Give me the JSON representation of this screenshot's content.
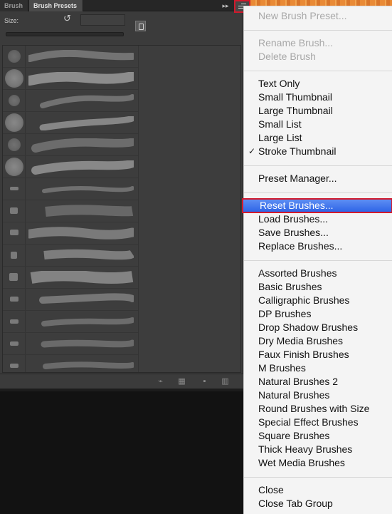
{
  "panel": {
    "tabs": [
      {
        "label": "Brush"
      },
      {
        "label": "Brush Presets"
      }
    ],
    "size_label": "Size:",
    "size_value": ""
  },
  "icons": {
    "collapse": "double-chevron-right-icon",
    "panel_menu": "panel-menu-icon",
    "reset_size": "reset-arrow-icon",
    "create_brush": "create-new-brush-icon",
    "toggle_brush_panel": "brush-panel-icon",
    "open_preset_manager": "grid-icon",
    "new_preset": "new-page-icon",
    "delete": "trash-icon"
  },
  "colors": {
    "panel_bg": "#3b3b3b",
    "menu_bg": "#f4f4f4",
    "highlight": "#2f65e7",
    "callout_border": "#d2192c"
  },
  "menu": {
    "new_brush_preset": "New Brush Preset...",
    "rename_brush": "Rename Brush...",
    "delete_brush": "Delete Brush",
    "text_only": "Text Only",
    "small_thumbnail": "Small Thumbnail",
    "large_thumbnail": "Large Thumbnail",
    "small_list": "Small List",
    "large_list": "Large List",
    "stroke_thumbnail": "Stroke Thumbnail",
    "checkmark": "✓",
    "preset_manager": "Preset Manager...",
    "reset_brushes": "Reset Brushes...",
    "load_brushes": "Load Brushes...",
    "save_brushes": "Save Brushes...",
    "replace_brushes": "Replace Brushes...",
    "libraries": [
      "Assorted Brushes",
      "Basic Brushes",
      "Calligraphic Brushes",
      "DP Brushes",
      "Drop Shadow Brushes",
      "Dry Media Brushes",
      "Faux Finish Brushes",
      "M Brushes",
      "Natural Brushes 2",
      "Natural Brushes",
      "Round Brushes with Size",
      "Special Effect Brushes",
      "Square Brushes",
      "Thick Heavy Brushes",
      "Wet Media Brushes"
    ],
    "close": "Close",
    "close_tab_group": "Close Tab Group"
  }
}
